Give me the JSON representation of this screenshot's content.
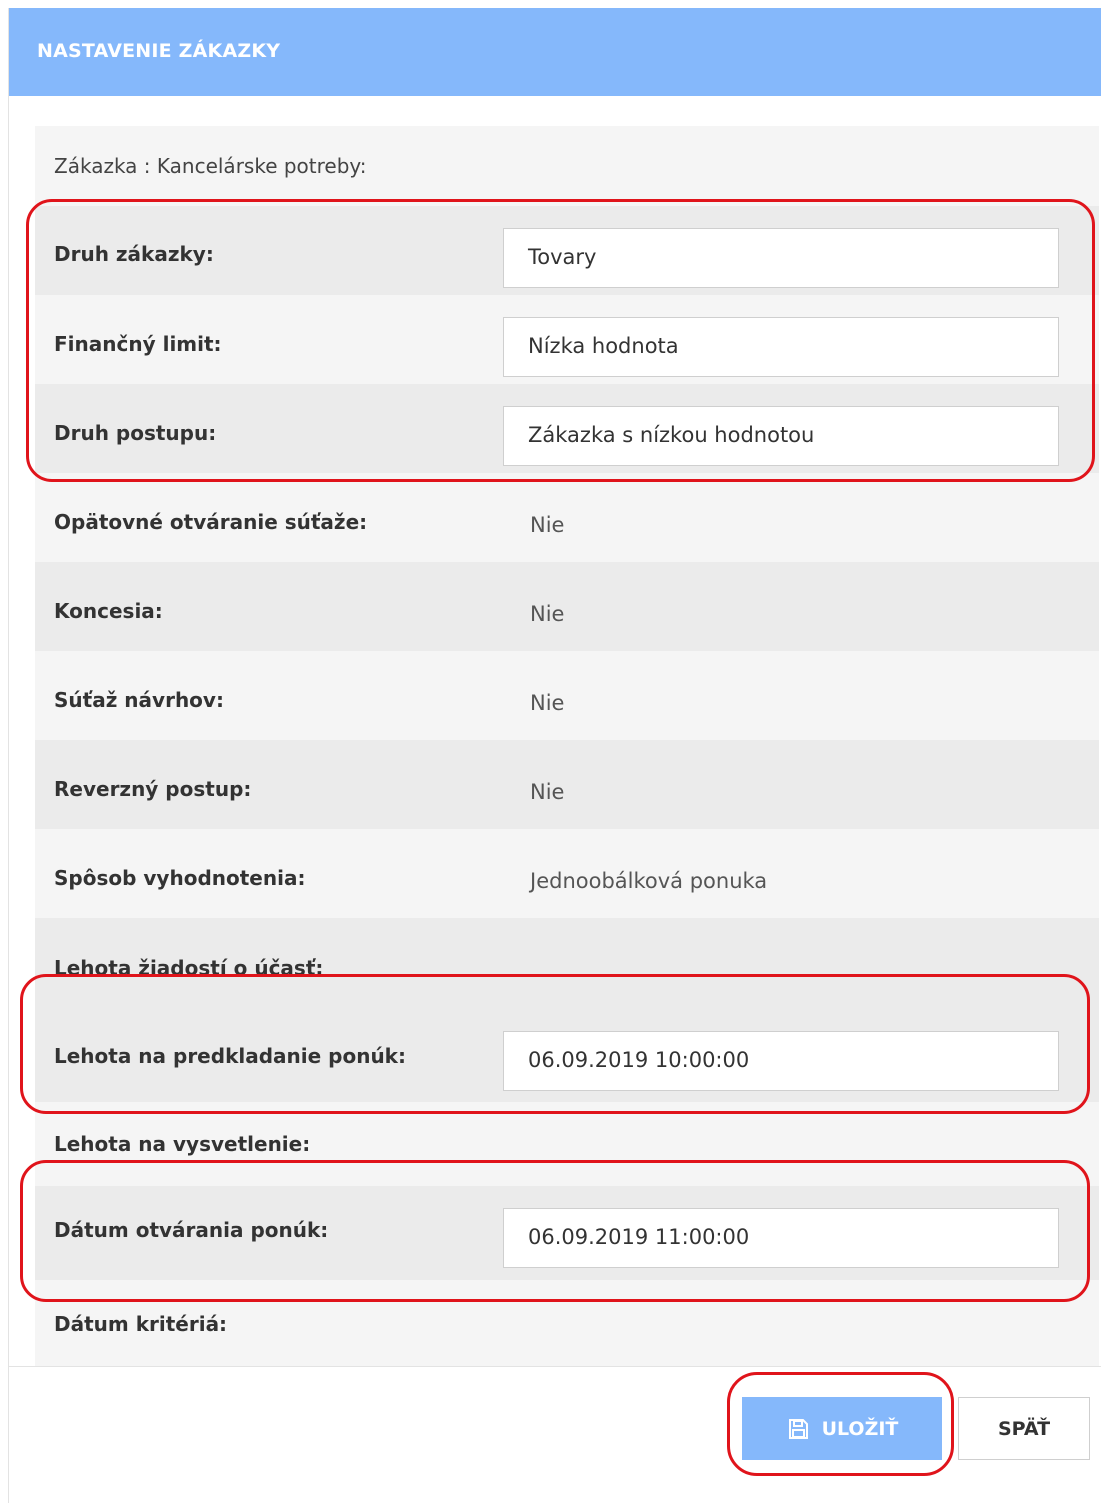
{
  "header": {
    "title": "NASTAVENIE ZÁKAZKY"
  },
  "summary": "Zákazka : Kancelárske potreby:",
  "fields": {
    "druh_zakazky": {
      "label": "Druh zákazky:",
      "value": "Tovary"
    },
    "financny_limit": {
      "label": "Finančný limit:",
      "value": "Nízka hodnota"
    },
    "druh_postupu": {
      "label": "Druh postupu:",
      "value": "Zákazka s nízkou hodnotou"
    }
  },
  "info": {
    "opatovne": {
      "label": "Opätovné otváranie súťaže:",
      "value": "Nie"
    },
    "koncesia": {
      "label": "Koncesia:",
      "value": "Nie"
    },
    "sutaz": {
      "label": "Súťaž návrhov:",
      "value": "Nie"
    },
    "reverzny": {
      "label": "Reverzný postup:",
      "value": "Nie"
    },
    "sposob": {
      "label": "Spôsob vyhodnotenia:",
      "value": "Jednoobálková ponuka"
    }
  },
  "deadlines": {
    "ziadosti": {
      "label": "Lehota žiadostí o účasť:"
    },
    "predkladanie": {
      "label": "Lehota na predkladanie ponúk:",
      "value": "06.09.2019 10:00:00"
    },
    "vysvetlenie": {
      "label": "Lehota na vysvetlenie:"
    },
    "otvaranie": {
      "label": "Dátum otvárania ponúk:",
      "value": "06.09.2019 11:00:00"
    },
    "kriteria": {
      "label": "Dátum kritériá:"
    }
  },
  "buttons": {
    "save": "ULOŽIŤ",
    "back": "SPÄŤ"
  },
  "icons": {
    "save": "save-icon"
  },
  "colors": {
    "accent": "#85b8fb",
    "highlight": "#e0141b"
  }
}
